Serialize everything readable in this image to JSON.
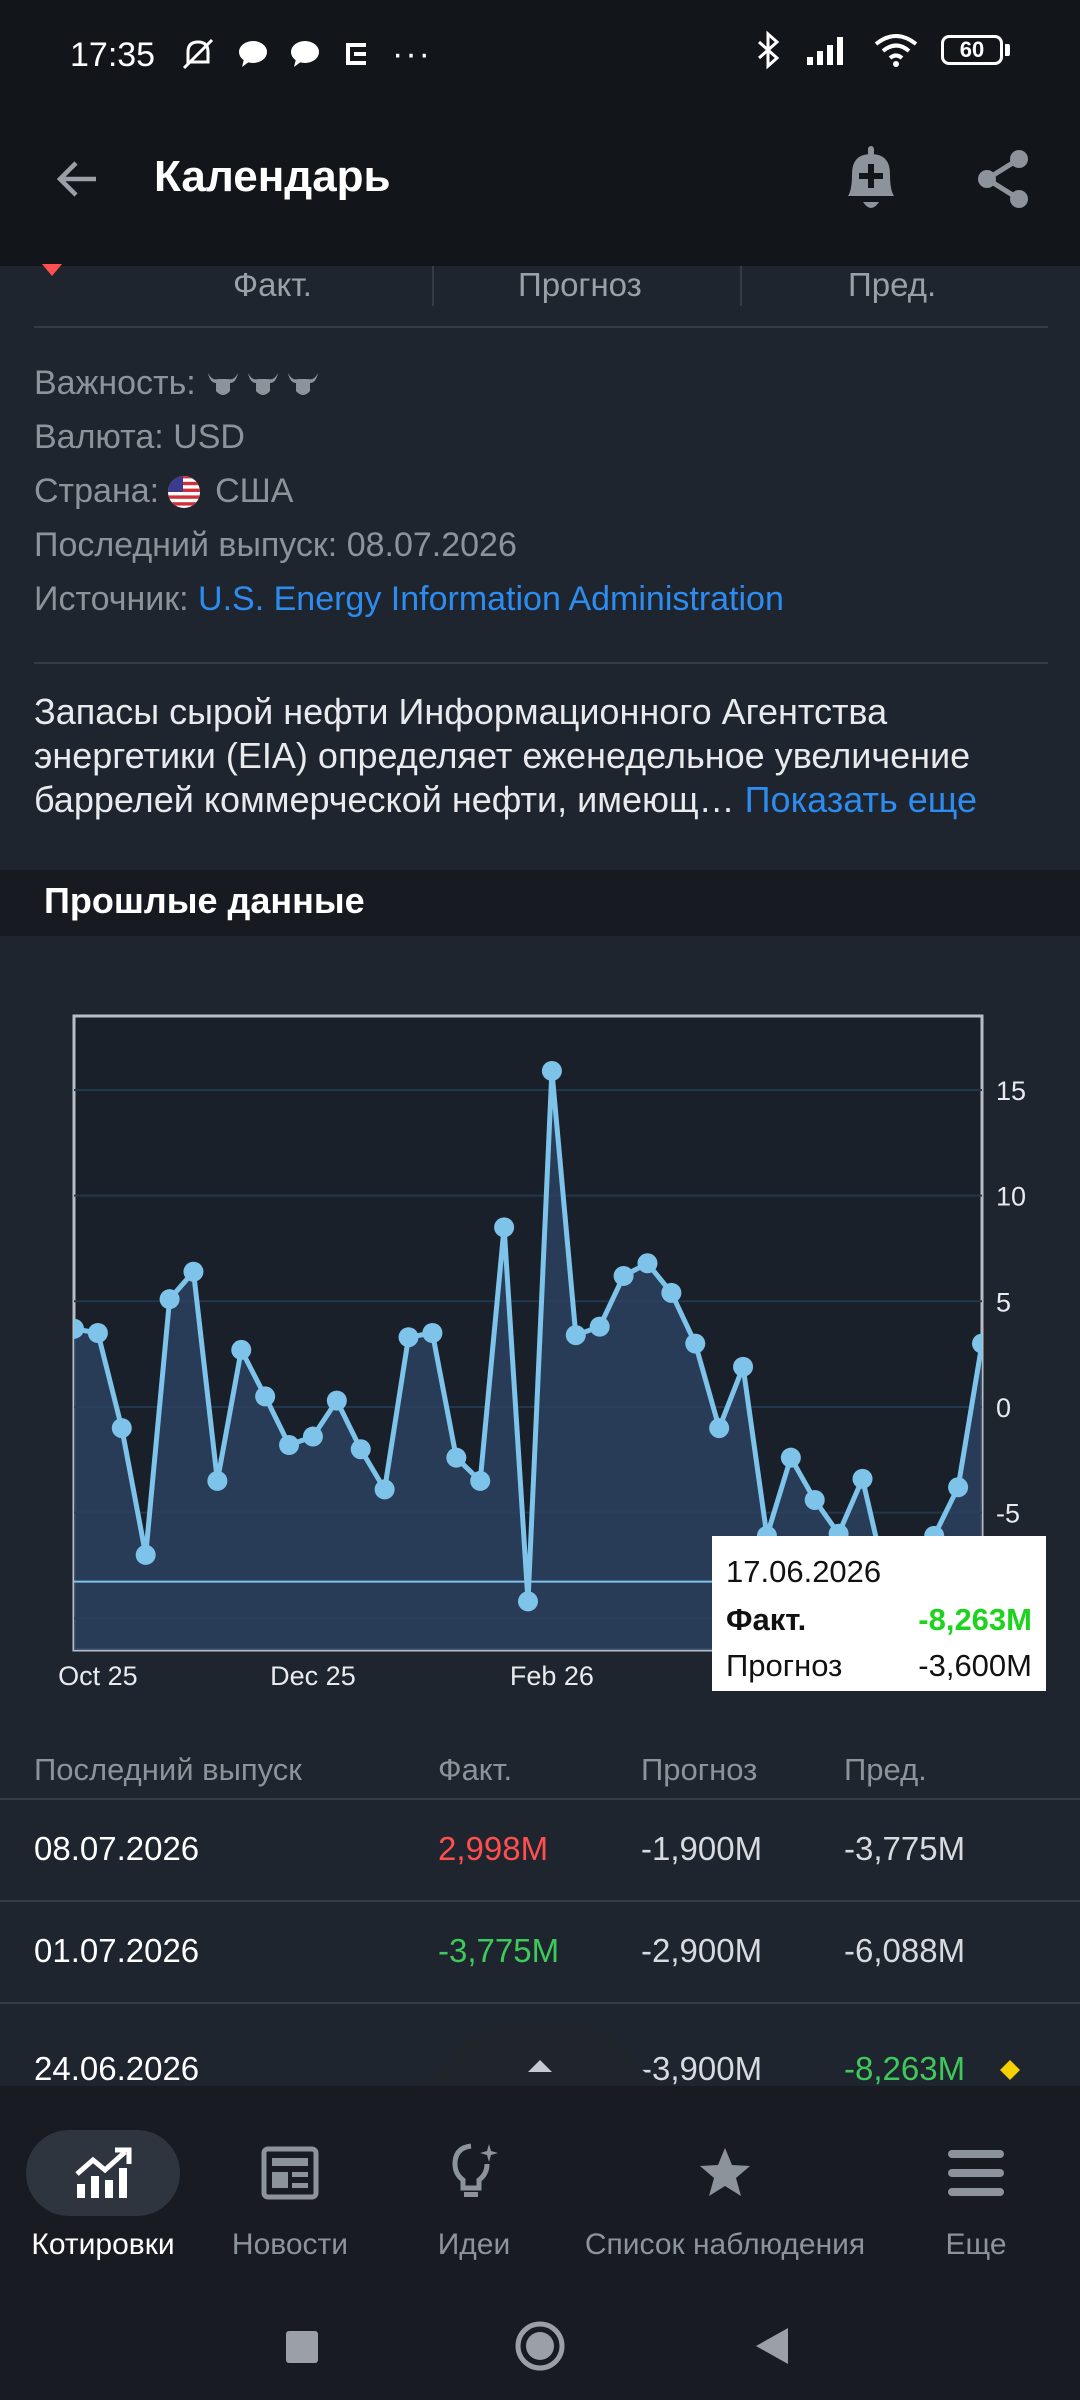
{
  "status_bar": {
    "time": "17:35",
    "battery": "60"
  },
  "app_bar": {
    "title": "Календарь"
  },
  "columns": {
    "fact": "Факт.",
    "forecast": "Прогноз",
    "previous": "Пред."
  },
  "info": {
    "importance_label": "Важность:",
    "currency_label": "Валюта:",
    "currency_value": "USD",
    "country_label": "Страна:",
    "country_value": "США",
    "last_release_label": "Последний выпуск:",
    "last_release_value": "08.07.2026",
    "source_label": "Источник:",
    "source_value": "U.S. Energy Information Administration"
  },
  "description": {
    "text": "Запасы сырой нефти Информационного Агентства энергетики (EIA) определяет еженедельное увеличение баррелей коммерческой нефти, имеющ…",
    "show_more": "Показать еще"
  },
  "past_data_title": "Прошлые данные",
  "chart_data": {
    "type": "area",
    "x_tick_labels": [
      "Oct 25",
      "Dec 25",
      "Feb 26"
    ],
    "y_ticks": [
      15,
      10,
      5,
      0,
      -5
    ],
    "ylim": [
      -11.5,
      18.5
    ],
    "grid": true,
    "values": [
      3.7,
      3.5,
      -1.0,
      -7.0,
      5.1,
      6.4,
      -3.5,
      2.7,
      0.5,
      -1.8,
      -1.4,
      0.3,
      -2.0,
      -3.9,
      3.3,
      3.5,
      -2.4,
      -3.5,
      8.5,
      -9.2,
      15.9,
      3.4,
      3.8,
      6.2,
      6.8,
      5.4,
      3.0,
      -1.0,
      1.9,
      -6.1,
      -2.4,
      -4.4,
      -6.0,
      -3.4,
      -8.3,
      -8.0,
      -6.1,
      -3.8,
      3.0
    ],
    "highlight_value": -8.263
  },
  "tooltip": {
    "date": "17.06.2026",
    "fact_label": "Факт.",
    "fact_value": "-8,263M",
    "forecast_label": "Прогноз",
    "forecast_value": "-3,600M"
  },
  "table": {
    "headers": [
      "Последний выпуск",
      "Факт.",
      "Прогноз",
      "Пред."
    ],
    "rows": [
      {
        "date": "08.07.2026",
        "fact": "2,998M",
        "forecast": "-1,900M",
        "previous": "-3,775M"
      },
      {
        "date": "01.07.2026",
        "fact": "-3,775M",
        "forecast": "-2,900M",
        "previous": "-6,088M"
      },
      {
        "date": "24.06.2026",
        "fact": "",
        "forecast": "-3,900M",
        "previous": "-8,263M"
      }
    ]
  },
  "colors": {
    "fact_up": "#ff4f4f",
    "fact_down": "#3ec95a",
    "link": "#2d8cf0",
    "chart_line": "#7ec3ea",
    "tooltip_green": "#1ed31e",
    "marker": "#f5d000"
  },
  "bottom_nav": [
    {
      "label": "Котировки",
      "icon": "chart-up-icon"
    },
    {
      "label": "Новости",
      "icon": "newspaper-icon"
    },
    {
      "label": "Идеи",
      "icon": "lightbulb-icon"
    },
    {
      "label": "Список наблюдения",
      "icon": "star-icon"
    },
    {
      "label": "Еще",
      "icon": "menu-icon"
    }
  ]
}
